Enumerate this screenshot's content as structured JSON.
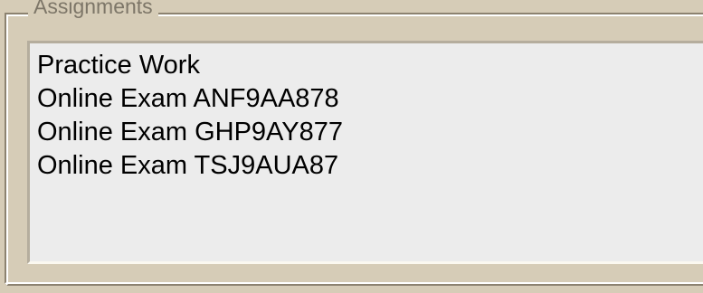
{
  "groupbox": {
    "title": "Assignments"
  },
  "list": {
    "items": [
      {
        "label": "Practice Work"
      },
      {
        "label": "Online Exam ANF9AA878"
      },
      {
        "label": "Online Exam GHP9AY877"
      },
      {
        "label": "Online Exam TSJ9AUA87"
      }
    ]
  },
  "colors": {
    "panel_background": "#d6ccb7",
    "list_background": "#ececec",
    "legend_text": "#7d7668"
  }
}
